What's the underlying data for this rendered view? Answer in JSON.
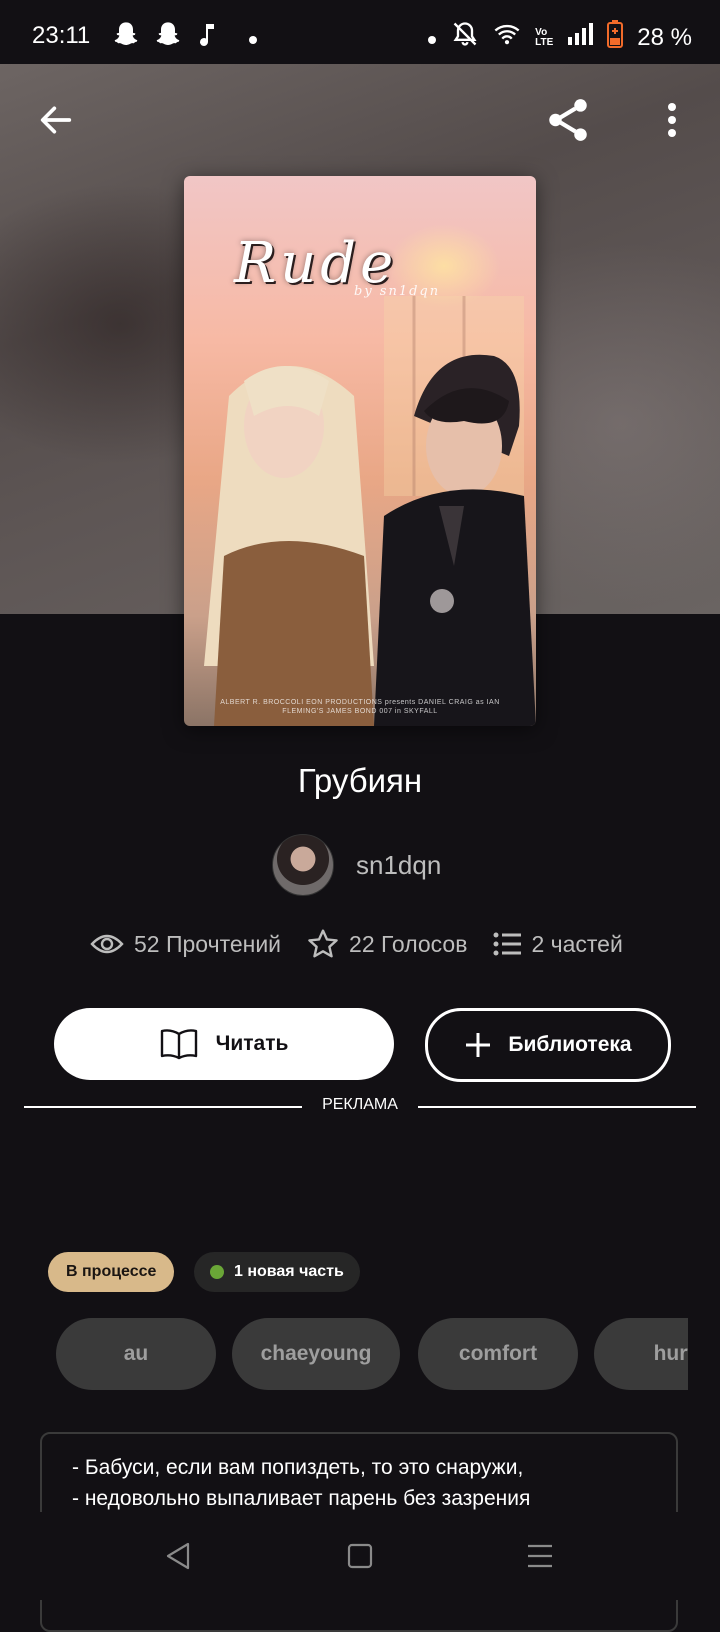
{
  "status_bar": {
    "time": "23:11",
    "battery": "28 %",
    "icons": [
      "snapchat-icon",
      "snapchat-icon",
      "music-note-icon",
      "dot-icon",
      "dot-icon",
      "bell-off-icon",
      "wifi-icon",
      "volte-icon",
      "signal-icon",
      "battery-icon"
    ],
    "volte_line1": "Vo",
    "volte_line2": "LTE"
  },
  "topbar": {
    "back_icon": "arrow-left-icon",
    "share_icon": "share-icon",
    "more_icon": "more-vertical-icon"
  },
  "cover": {
    "title_art": "Rude",
    "subtitle_art": "by sn1dqn",
    "credits_art": "ALBERT R. BROCCOLI EON PRODUCTIONS presents DANIEL CRAIG as IAN FLEMING'S JAMES BOND 007 in SKYFALL"
  },
  "story": {
    "title": "Грубиян",
    "author": "sn1dqn"
  },
  "stats": {
    "reads": "52 Прочтений",
    "votes": "22 Голосов",
    "parts": "2 частей"
  },
  "actions": {
    "read_label": "Читать",
    "library_label": "Библиотека"
  },
  "ad": {
    "label": "РЕКЛАМА"
  },
  "badges": {
    "status": "В процессе",
    "new_part": "1 новая часть",
    "new_part_dot_color": "#6aa637",
    "status_color": "#d8b98a"
  },
  "tags": [
    "au",
    "chaeyoung",
    "comfort",
    "hurt"
  ],
  "description": {
    "line1": "- Бабуси, если вам попиздеть, то это снаружи,",
    "line2": "- недовольно выпаливает парень без зазрения"
  },
  "nav": {
    "back": "triangle-back-icon",
    "home": "square-home-icon",
    "menu": "menu-lines-icon"
  }
}
